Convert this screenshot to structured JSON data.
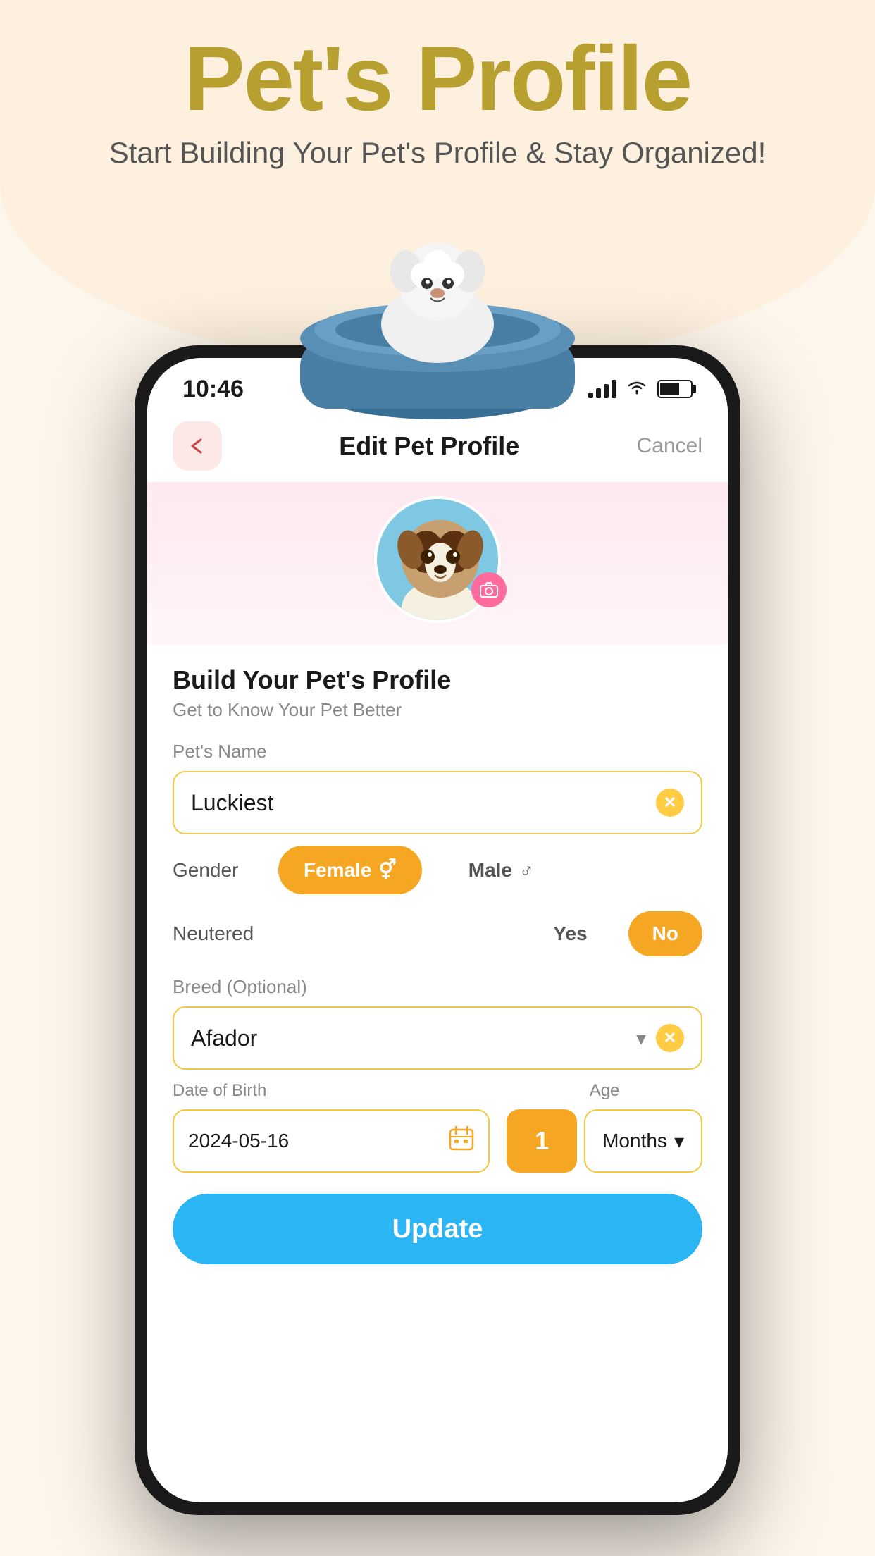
{
  "page": {
    "background_color": "#fdf6ec",
    "arc_color": "#fdf0de"
  },
  "header": {
    "title": "Pet's Profile",
    "subtitle": "Start Building Your Pet's Profile & Stay Organized!"
  },
  "status_bar": {
    "time": "10:46",
    "signal_label": "signal",
    "wifi_label": "wifi",
    "battery_label": "battery"
  },
  "nav": {
    "back_label": "<",
    "title": "Edit Pet Profile",
    "cancel_label": "Cancel"
  },
  "profile_section": {
    "title": "Build Your Pet's Profile",
    "subtitle": "Get to Know Your Pet Better"
  },
  "form": {
    "pet_name_label": "Pet's Name",
    "pet_name_value": "Luckiest",
    "gender_label": "Gender",
    "gender_female_label": "Female",
    "gender_male_label": "Male",
    "gender_female_icon": "♀",
    "gender_male_icon": "♂",
    "gender_selected": "Female",
    "neutered_label": "Neutered",
    "neutered_yes_label": "Yes",
    "neutered_no_label": "No",
    "neutered_selected": "No",
    "breed_label": "Breed (Optional)",
    "breed_value": "Afador",
    "dob_label": "Date of Birth",
    "dob_value": "2024-05-16",
    "age_label": "Age",
    "age_value": "1",
    "age_unit": "Months",
    "update_label": "Update"
  },
  "colors": {
    "primary_yellow": "#f5a623",
    "border_yellow": "#f5c842",
    "accent_blue": "#2ab5f5",
    "accent_pink": "#ff6b9d",
    "light_pink_bg": "#fde8f0",
    "dark_text": "#1a1a1a",
    "muted_text": "#888888",
    "active_btn_bg": "#f5a623",
    "active_btn_text": "#ffffff"
  }
}
